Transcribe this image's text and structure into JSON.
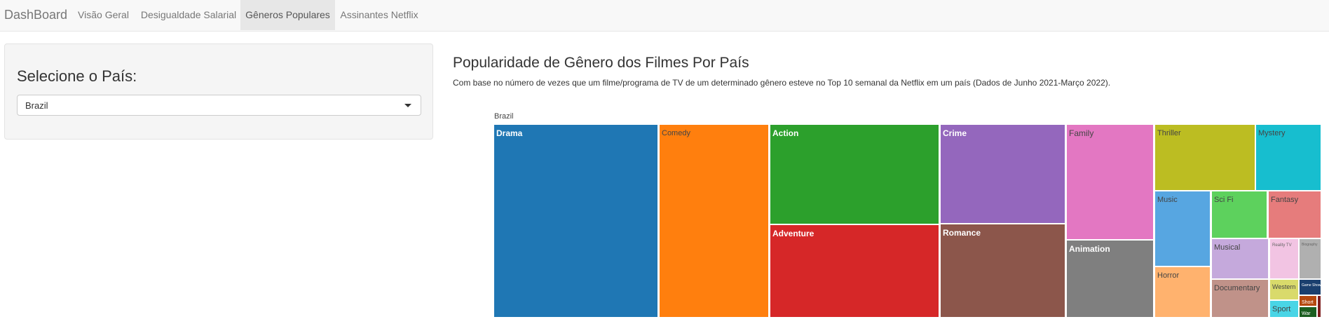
{
  "navbar": {
    "brand": "DashBoard",
    "tabs": [
      {
        "label": "Visão Geral"
      },
      {
        "label": "Desigualdade Salarial"
      },
      {
        "label": "Gêneros Populares"
      },
      {
        "label": "Assinantes Netflix"
      }
    ],
    "active_tab": 2
  },
  "sidebar": {
    "label": "Selecione o País:",
    "select": {
      "value": "Brazil"
    }
  },
  "main": {
    "title": "Popularidade de Gênero dos Filmes Por País",
    "subtitle": "Com base no número de vezes que um filme/programa de TV de um determinado gênero esteve no Top 10 semanal da Netflix em um país (Dados de Junho 2021-Março 2022)."
  },
  "chart_data": {
    "type": "treemap",
    "root_label": "Brazil",
    "tiles": [
      {
        "label": "Drama",
        "color": "#1f77b4",
        "text_color": "#ffffff"
      },
      {
        "label": "Comedy",
        "color": "#ff7f0e",
        "text_color": "#444444"
      },
      {
        "label": "Action",
        "color": "#2ca02c",
        "text_color": "#ffffff"
      },
      {
        "label": "Adventure",
        "color": "#d62728",
        "text_color": "#ffffff"
      },
      {
        "label": "Crime",
        "color": "#9467bd",
        "text_color": "#ffffff"
      },
      {
        "label": "Romance",
        "color": "#8c564b",
        "text_color": "#ffffff"
      },
      {
        "label": "Family",
        "color": "#e377c2",
        "text_color": "#444444"
      },
      {
        "label": "Animation",
        "color": "#7f7f7f",
        "text_color": "#ffffff"
      },
      {
        "label": "Thriller",
        "color": "#bcbd22",
        "text_color": "#444444"
      },
      {
        "label": "Mystery",
        "color": "#17becf",
        "text_color": "#444444"
      },
      {
        "label": "Music",
        "color": "#57a6e1",
        "text_color": "#444444"
      },
      {
        "label": "Sci Fi",
        "color": "#5dd15d",
        "text_color": "#444444"
      },
      {
        "label": "Fantasy",
        "color": "#e67c7c",
        "text_color": "#444444"
      },
      {
        "label": "Horror",
        "color": "#ffb26e",
        "text_color": "#444444"
      },
      {
        "label": "Musical",
        "color": "#c5a9dc",
        "text_color": "#444444"
      },
      {
        "label": "Reality TV",
        "color": "#f2c4e3",
        "text_color": "#666666"
      },
      {
        "label": "Biography",
        "color": "#b0b0b0",
        "text_color": "#666666"
      },
      {
        "label": "Documentary",
        "color": "#c09289",
        "text_color": "#444444"
      },
      {
        "label": "Western",
        "color": "#d9da6b",
        "text_color": "#444444"
      },
      {
        "label": "Game Show",
        "color": "#1a3f6e",
        "text_color": "#ffffff"
      },
      {
        "label": "Sport",
        "color": "#49d5e6",
        "text_color": "#444444"
      },
      {
        "label": "Short",
        "color": "#b5480e",
        "text_color": "#ffffff"
      },
      {
        "label": "War",
        "color": "#1b5e20",
        "text_color": "#ffffff"
      },
      {
        "label": "",
        "color": "#7f1f1f",
        "text_color": "#ffffff"
      }
    ]
  }
}
